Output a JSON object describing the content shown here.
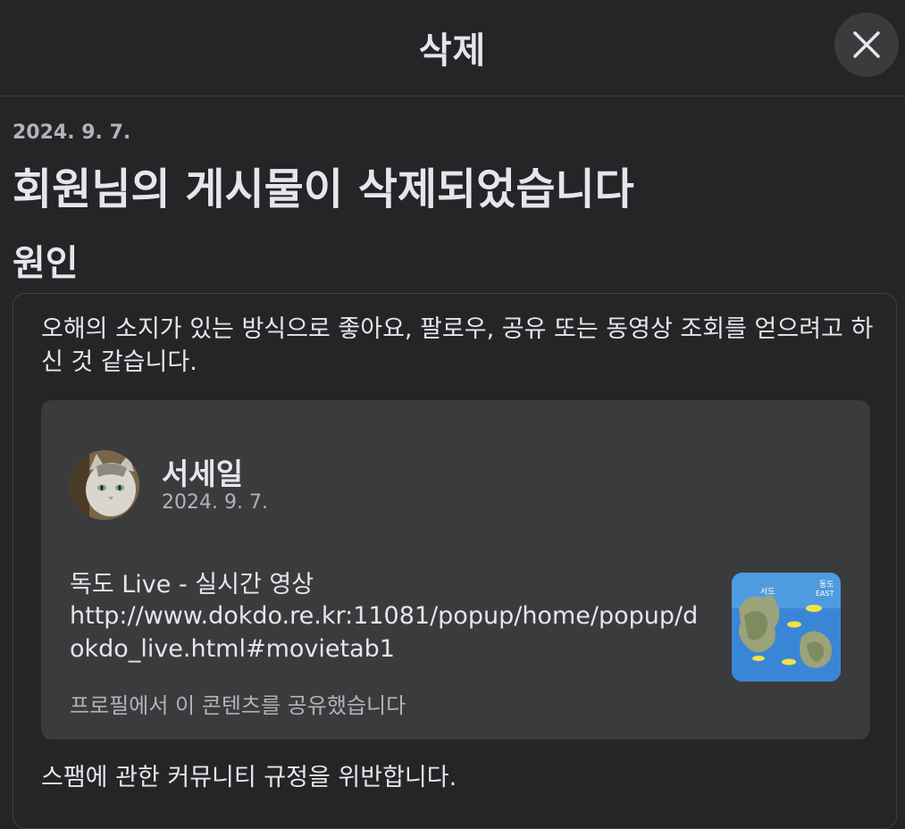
{
  "header": {
    "title": "삭제"
  },
  "notice": {
    "date": "2024. 9. 7.",
    "headline": "회원님의 게시물이 삭제되었습니다",
    "reason_title": "원인",
    "reason_text": "오해의 소지가 있는 방식으로 좋아요, 팔로우, 공유 또는 동영상 조회를 얻으려고 하신 것 같습니다.",
    "violation_text": "스팸에 관한 커뮤니티 규정을 위반합니다."
  },
  "post": {
    "author_name": "서세일",
    "author_date": "2024. 9. 7.",
    "link_title": "독도 Live - 실시간 영상",
    "link_url": "http://www.dokdo.re.kr:11081/popup/home/popup/dokdo_live.html#movietab1",
    "shared_note": "프로필에서 이 콘텐츠를 공유했습니다",
    "thumbnail_labels": {
      "west": "서도",
      "east_ko": "동도",
      "east_en": "EAST"
    }
  },
  "icons": {
    "close": "close-icon"
  },
  "colors": {
    "background": "#242526",
    "card": "#3a3b3c",
    "text": "#e4e6eb",
    "muted": "#b0b3b8"
  }
}
